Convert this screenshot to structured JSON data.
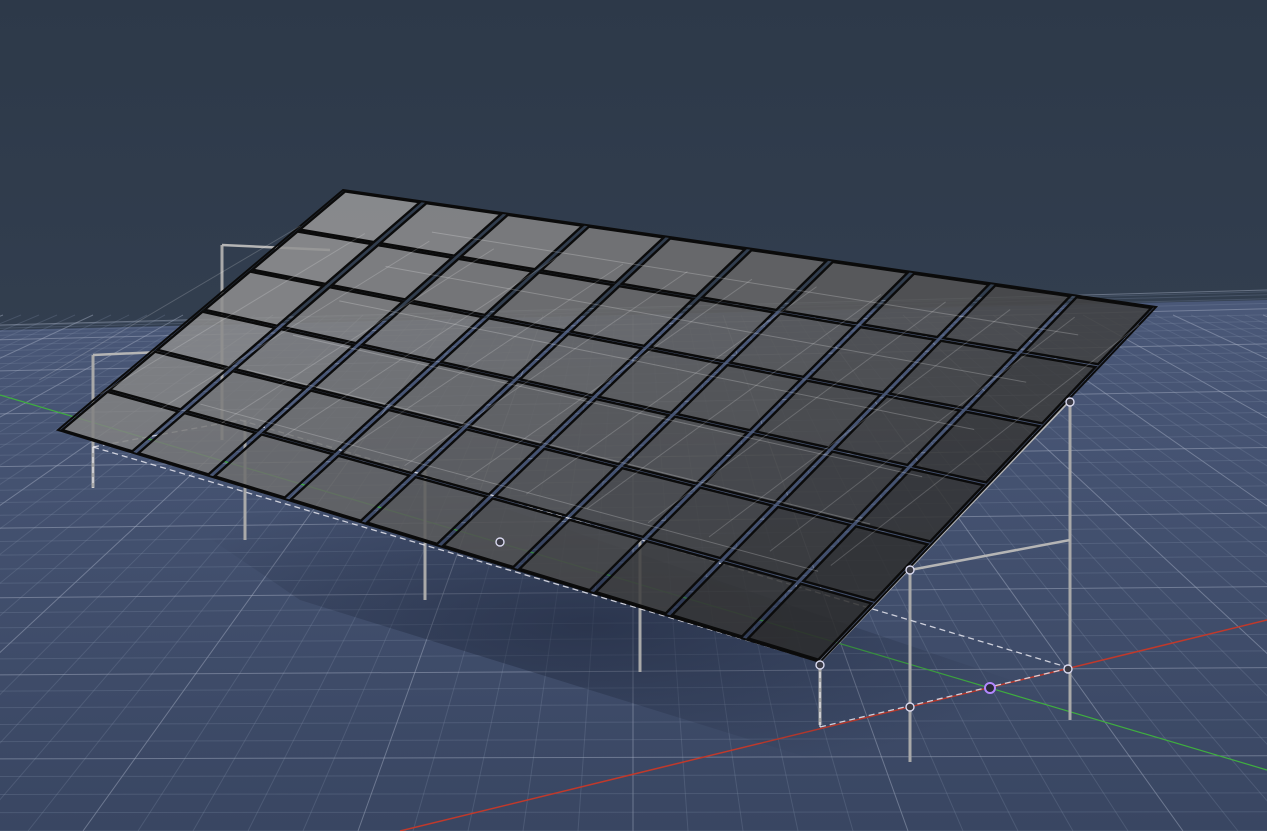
{
  "viewport": {
    "background_sky": "#2f3b4c",
    "background_horizon": "#3a4658",
    "ground_color": "#3e4c66",
    "grid_minor_color": "#7f8ca6",
    "grid_major_color": "#aab4c8",
    "axis_x_color": "#c0392b",
    "axis_y_color": "#3fae3f"
  },
  "panel_array": {
    "rows": 6,
    "columns": 10,
    "panel_fill_light": "#8a8a8a",
    "panel_fill_dark": "#2a2a2a",
    "panel_edge_color": "#0b0b0b"
  },
  "frame": {
    "post_color": "#a9a9a9",
    "rail_color": "#b5b5b5"
  },
  "selection": {
    "bbox_color": "#e8e8f0",
    "handle_color": "#d9d9ef",
    "pivot_color": "#b388ff"
  },
  "icons": {
    "pivot": "origin-pivot-icon",
    "handle": "bounding-box-handle-icon"
  }
}
